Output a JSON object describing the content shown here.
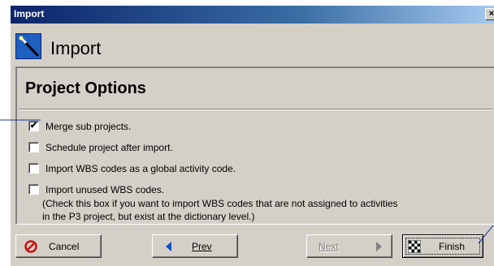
{
  "window": {
    "title": "Import",
    "close_glyph": "×"
  },
  "header": {
    "title": "Import",
    "icon": "wizard-wand-icon"
  },
  "section": {
    "title": "Project Options"
  },
  "options": [
    {
      "label": "Merge sub projects.",
      "checked": true,
      "mark": "✔"
    },
    {
      "label": "Schedule project after import.",
      "checked": false,
      "mark": ""
    },
    {
      "label": "Import WBS codes as a global activity code.",
      "checked": false,
      "mark": ""
    },
    {
      "label": "Import unused WBS codes.",
      "checked": false,
      "mark": ""
    }
  ],
  "note_lines": [
    "(Check this box if you want to import WBS codes that are not assigned to activities",
    "in the P3 project, but exist at the dictionary level.)"
  ],
  "buttons": {
    "cancel": "Cancel",
    "prev": "Prev",
    "next": "Next",
    "finish": "Finish"
  },
  "colors": {
    "accent_blue": "#0a246a",
    "callout": "#1a3a9a",
    "cancel_red": "#cc1010"
  }
}
